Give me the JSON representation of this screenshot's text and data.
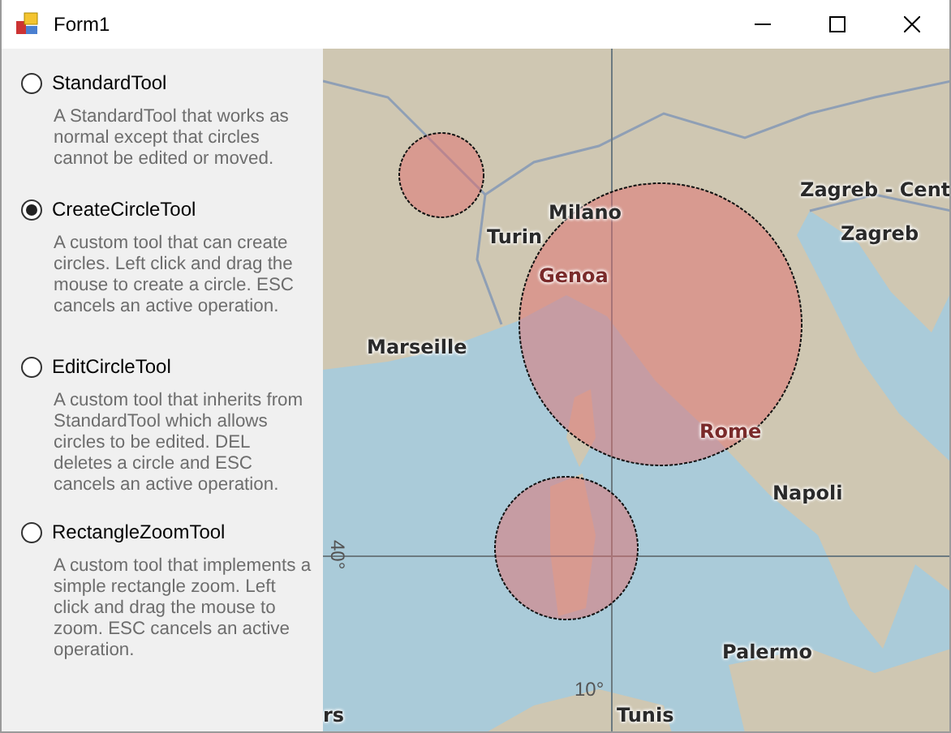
{
  "window": {
    "title": "Form1"
  },
  "tools": [
    {
      "label": "StandardTool",
      "selected": false,
      "description": "A StandardTool that works as normal except that circles cannot be edited or moved."
    },
    {
      "label": "CreateCircleTool",
      "selected": true,
      "description": "A custom tool that can create circles. Left click and drag the mouse to create a circle. ESC cancels an active operation."
    },
    {
      "label": "EditCircleTool",
      "selected": false,
      "description": "A custom tool that inherits from StandardTool which allows circles to be edited. DEL deletes a circle and ESC cancels an active operation."
    },
    {
      "label": "RectangleZoomTool",
      "selected": false,
      "description": "A custom tool that implements a simple rectangle zoom. Left click and drag the mouse to zoom. ESC cancels an active operation."
    }
  ],
  "map": {
    "labels": [
      {
        "text": "Zagreb - Cent",
        "kind": "city"
      },
      {
        "text": "Milano",
        "kind": "city"
      },
      {
        "text": "Turin",
        "kind": "city"
      },
      {
        "text": "Zagreb",
        "kind": "city"
      },
      {
        "text": "Genoa",
        "kind": "covered"
      },
      {
        "text": "Marseille",
        "kind": "city"
      },
      {
        "text": "Rome",
        "kind": "covered"
      },
      {
        "text": "Napoli",
        "kind": "city"
      },
      {
        "text": "Palermo",
        "kind": "city"
      },
      {
        "text": "40°",
        "kind": "grid"
      },
      {
        "text": "10°",
        "kind": "grid"
      },
      {
        "text": "rs",
        "kind": "city"
      },
      {
        "text": "Tunis",
        "kind": "city"
      }
    ]
  }
}
